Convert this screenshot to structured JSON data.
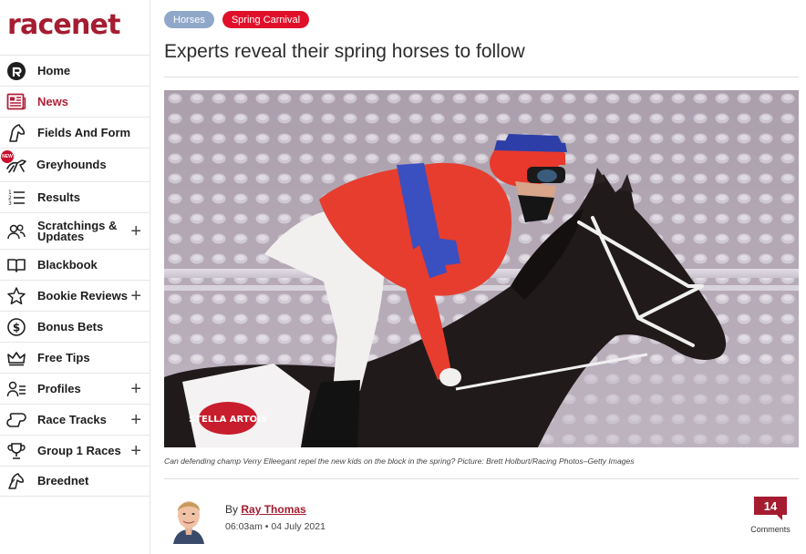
{
  "brand": {
    "logo_text": "racenet",
    "color": "#a51c30"
  },
  "nav": [
    {
      "id": "home",
      "label": "Home",
      "icon": "racenet-r-icon",
      "active": false,
      "expandable": false
    },
    {
      "id": "news",
      "label": "News",
      "icon": "newspaper-icon",
      "active": true,
      "expandable": false
    },
    {
      "id": "fields",
      "label": "Fields And Form",
      "icon": "horse-head-icon",
      "active": false,
      "expandable": false
    },
    {
      "id": "greyhounds",
      "label": "Greyhounds",
      "icon": "greyhound-icon",
      "active": false,
      "expandable": false,
      "badge": "NEW"
    },
    {
      "id": "results",
      "label": "Results",
      "icon": "numbered-list-icon",
      "active": false,
      "expandable": false
    },
    {
      "id": "scratchings",
      "label": "Scratchings & Updates",
      "icon": "users-icon",
      "active": false,
      "expandable": true
    },
    {
      "id": "blackbook",
      "label": "Blackbook",
      "icon": "book-icon",
      "active": false,
      "expandable": false
    },
    {
      "id": "bookie",
      "label": "Bookie Reviews",
      "icon": "star-icon",
      "active": false,
      "expandable": true
    },
    {
      "id": "bonus",
      "label": "Bonus Bets",
      "icon": "dollar-icon",
      "active": false,
      "expandable": false
    },
    {
      "id": "tips",
      "label": "Free Tips",
      "icon": "crown-icon",
      "active": false,
      "expandable": false
    },
    {
      "id": "profiles",
      "label": "Profiles",
      "icon": "person-list-icon",
      "active": false,
      "expandable": true
    },
    {
      "id": "tracks",
      "label": "Race Tracks",
      "icon": "track-icon",
      "active": false,
      "expandable": true
    },
    {
      "id": "group1",
      "label": "Group 1 Races",
      "icon": "trophy-icon",
      "active": false,
      "expandable": true
    },
    {
      "id": "breednet",
      "label": "Breednet",
      "icon": "breednet-horse-icon",
      "active": false,
      "expandable": false
    }
  ],
  "article": {
    "tags": [
      "Horses",
      "Spring Carnival"
    ],
    "tag_colors": [
      "#8fa7c9",
      "#e0102b"
    ],
    "title": "Experts reveal their spring horses to follow",
    "image_alt": "Jockey in red and blue silks riding a dark bay horse",
    "caption": "Can defending champ Verry Elleegant repel the new kids on the block in the spring? Picture: Brett Holburt/Racing Photos–Getty Images",
    "author_prefix": "By",
    "author": "Ray Thomas",
    "time": "06:03am",
    "date": "04 July 2021",
    "comments_count": "14",
    "comments_label": "Comments",
    "saddlecloth_text": "STELLA ARTOIS"
  }
}
